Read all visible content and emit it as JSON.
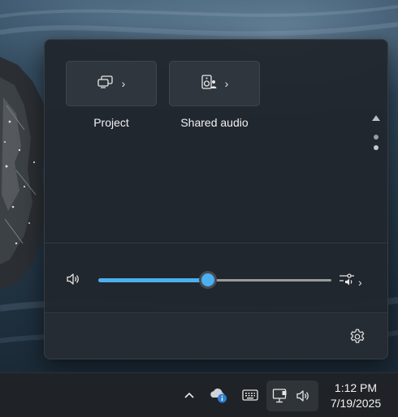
{
  "quick_settings": {
    "tiles": [
      {
        "label": "Project",
        "icon": "project-icon",
        "chevron": "›"
      },
      {
        "label": "Shared audio",
        "icon": "shared-audio-icon",
        "chevron": "›"
      }
    ],
    "pager": {
      "icon_up": "caret-up-icon",
      "pages": 2,
      "current_page": 1
    },
    "volume": {
      "icon": "speaker-icon",
      "level": 0.47,
      "mixer_icon": "audio-mixer-icon",
      "mixer_chevron": "›"
    },
    "footer": {
      "settings_icon": "gear-icon"
    }
  },
  "taskbar": {
    "tray_icons": [
      "chevron-up-icon",
      "onedrive-icon",
      "keyboard-icon",
      "network-icon",
      "speaker-icon"
    ],
    "time": "1:12 PM",
    "date": "7/19/2025"
  },
  "colors": {
    "accent": "#4cb0f0",
    "flyout_bg": "#21272e",
    "taskbar_bg": "#1f2327"
  }
}
